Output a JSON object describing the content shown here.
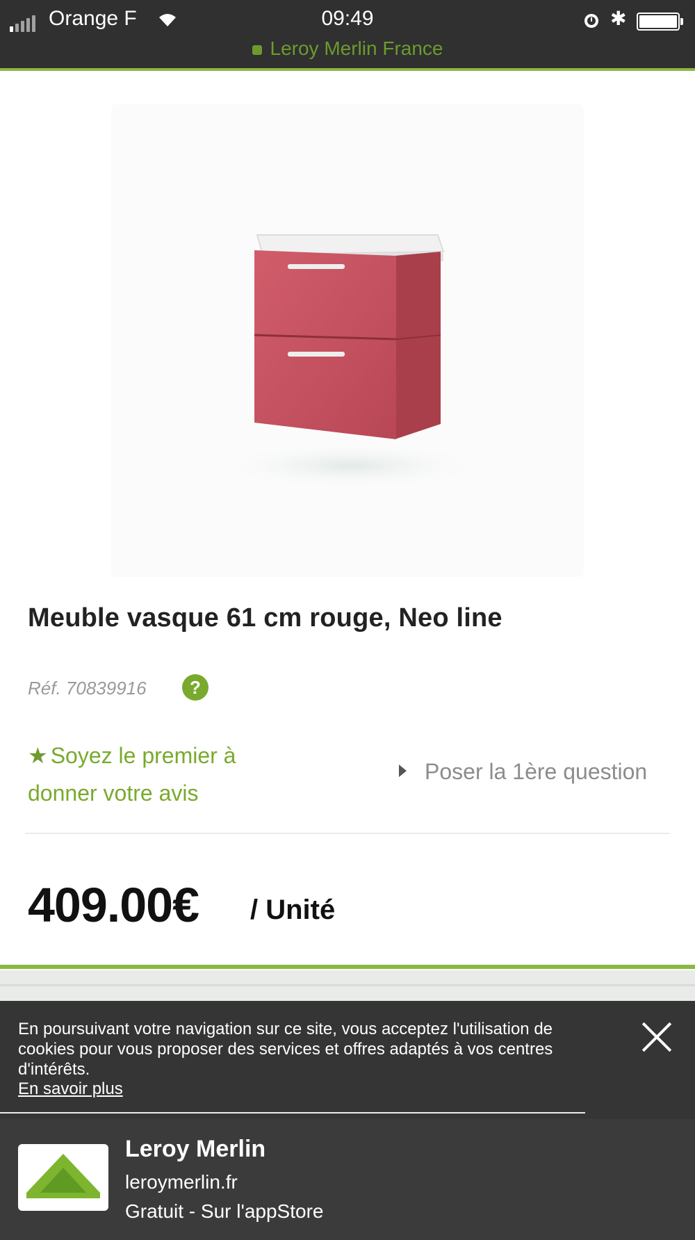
{
  "status_bar": {
    "carrier": "Orange F",
    "time": "09:49",
    "url": "Leroy Merlin France"
  },
  "product": {
    "title": "Meuble vasque 61 cm rouge, Neo line",
    "reference": "Réf. 70839916",
    "help_icon": "?",
    "review_star_icon": "star-icon",
    "review_link": "Soyez le premier à donner votre avis",
    "question_link": "Poser la 1ère question",
    "price": "409.00€",
    "unit": "/ Unité"
  },
  "cookie_banner": {
    "text": "En poursuivant votre navigation sur ce site, vous acceptez l'utilisation de cookies pour vous proposer des services et offres adaptés à vos centres d'intérêts.",
    "link": "En savoir plus",
    "close_icon": "close-icon"
  },
  "app_banner": {
    "name": "Leroy Merlin",
    "domain": "leroymerlin.fr",
    "store": "Gratuit - Sur l'appStore"
  },
  "colors": {
    "brand_green": "#79aa2d",
    "status_bar_bg": "#2f302f",
    "banner_bg": "#343534",
    "cabinet_red": "#c6505f"
  }
}
